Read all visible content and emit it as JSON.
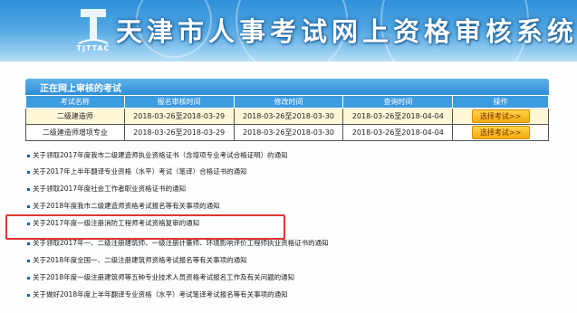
{
  "header": {
    "logo_text": "TJTTAC",
    "title": "天津市人事考试网上资格审核系统"
  },
  "section": {
    "title": "正在网上审核的考试"
  },
  "table": {
    "columns": [
      "考试名称",
      "报名审核时间",
      "修改时间",
      "查询时间",
      "操作"
    ],
    "rows": [
      [
        "二级建造师",
        "2018-03-26至2018-03-29",
        "2018-03-26至2018-03-30",
        "2018-03-26至2018-04-04",
        "选择考试>>"
      ],
      [
        "二级建造师增项专业",
        "2018-03-26至2018-03-29",
        "2018-03-26至2018-03-30",
        "2018-03-26至2018-04-04",
        "选择考试>>"
      ]
    ]
  },
  "news": [
    "关于领取2017年度我市二级建造师执业资格证书（含增项专业考试合格证明）的通知",
    "关于2017年上半年翻译专业资格（水平）考试（笔译）合格证书的通知",
    "关于领取2017年度社会工作者职业资格证书的通知",
    "关于2018年度我市二级建造师资格考试报名等有关事项的通知",
    "关于2017年度一级注册消防工程师考试资格复审的通知",
    "关于领取2017年一、二级注册建筑师、一级注册计量师、环境影响评价工程师执业资格证书的通知",
    "关于2018年度全国一、二级注册建筑师资格考试报名等有关事项的通知",
    "关于2018年度一级注册建筑师等五种专业技术人员资格考试报名工作及有关问题的通知",
    "关于做好2018年度上半年翻译专业资格（水平）考试笔译考试报名等有关事项的通知"
  ],
  "colors": {
    "header_top": "#2f8fd8",
    "table_header": "#3d9be0",
    "highlight_box": "#e23434",
    "button": "#f4a90f"
  }
}
